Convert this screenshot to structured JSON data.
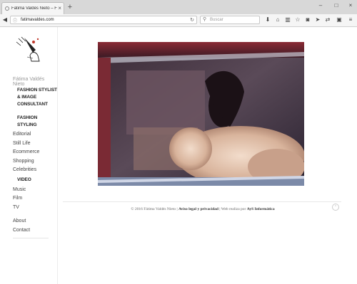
{
  "browser": {
    "tab_title": "Fátima Valdés Nieto – Fáti...",
    "url": "fatimavaldes.com",
    "search_placeholder": "Buscar"
  },
  "sidebar": {
    "brand": "Fátima Valdés Nieto",
    "cat_fashion_stylist": [
      "FASHION STYLIST",
      "& IMAGE",
      "CONSULTANT"
    ],
    "cat_fashion_styling": [
      "FASHION",
      "STYLING"
    ],
    "styling_items": [
      "Editorial",
      "Still Life",
      "Ecommerce",
      "Shopping",
      "Celebrities"
    ],
    "cat_video": "VIDEO",
    "video_items": [
      "Music",
      "Film",
      "TV"
    ],
    "bottom_items": [
      "About",
      "Contact"
    ]
  },
  "footer": {
    "copyright": "© 2016 Fátima Valdés Nieto |",
    "legal": "Aviso legal y privacidad",
    "made_by": "| Web realiza por",
    "agency": "AyS Informática"
  },
  "colors": {
    "accent": "#c0392b",
    "text": "#222222",
    "muted": "#999999"
  }
}
